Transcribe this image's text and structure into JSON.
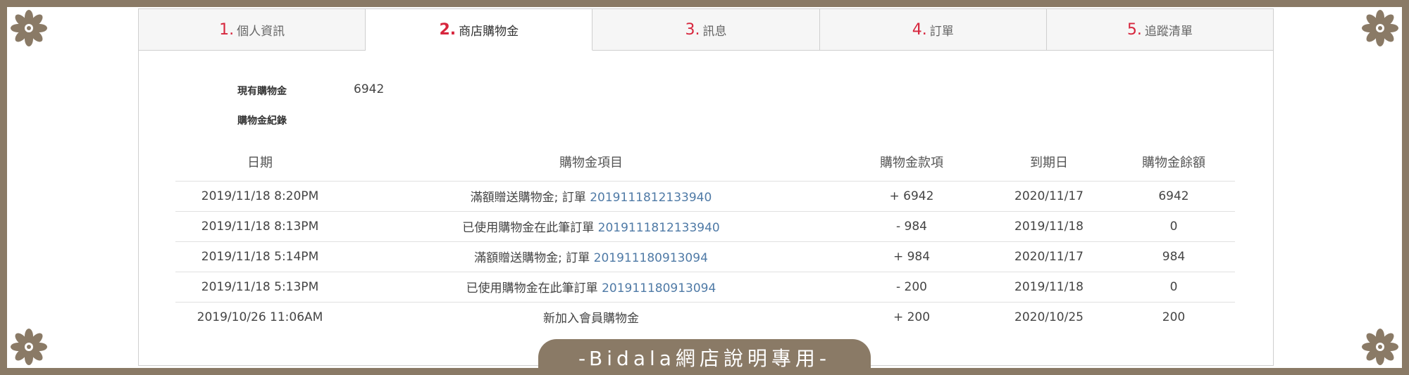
{
  "colors": {
    "frame": "#8a7a66",
    "accent": "#d7263d",
    "link": "#4f7aa6"
  },
  "tabs": [
    {
      "num": "1.",
      "label": "個人資訊",
      "active": false
    },
    {
      "num": "2.",
      "label": "商店購物金",
      "active": true
    },
    {
      "num": "3.",
      "label": "訊息",
      "active": false
    },
    {
      "num": "4.",
      "label": "訂單",
      "active": false
    },
    {
      "num": "5.",
      "label": "追蹤清單",
      "active": false
    }
  ],
  "summary": {
    "balance_label": "現有購物金",
    "balance_value": "6942",
    "history_label": "購物金紀錄"
  },
  "table": {
    "headers": [
      "日期",
      "購物金項目",
      "購物金款項",
      "到期日",
      "購物金餘額"
    ],
    "rows": [
      {
        "date": "2019/11/18 8:20PM",
        "item_text": "滿額贈送購物金; 訂單 ",
        "order": "2019111812133940",
        "amount": "+ 6942",
        "expiry": "2020/11/17",
        "balance": "6942"
      },
      {
        "date": "2019/11/18 8:13PM",
        "item_text": "已使用購物金在此筆訂單 ",
        "order": "2019111812133940",
        "amount": "- 984",
        "expiry": "2019/11/18",
        "balance": "0"
      },
      {
        "date": "2019/11/18 5:14PM",
        "item_text": "滿額贈送購物金; 訂單 ",
        "order": "201911180913094",
        "amount": "+ 984",
        "expiry": "2020/11/17",
        "balance": "984"
      },
      {
        "date": "2019/11/18 5:13PM",
        "item_text": "已使用購物金在此筆訂單 ",
        "order": "201911180913094",
        "amount": "- 200",
        "expiry": "2019/11/18",
        "balance": "0"
      },
      {
        "date": "2019/10/26 11:06AM",
        "item_text": "新加入會員購物金",
        "order": "",
        "amount": "+ 200",
        "expiry": "2020/10/25",
        "balance": "200"
      }
    ]
  },
  "watermark": "-Bidala網店說明專用-",
  "icons": {
    "corner": "flower-ornament-icon"
  }
}
